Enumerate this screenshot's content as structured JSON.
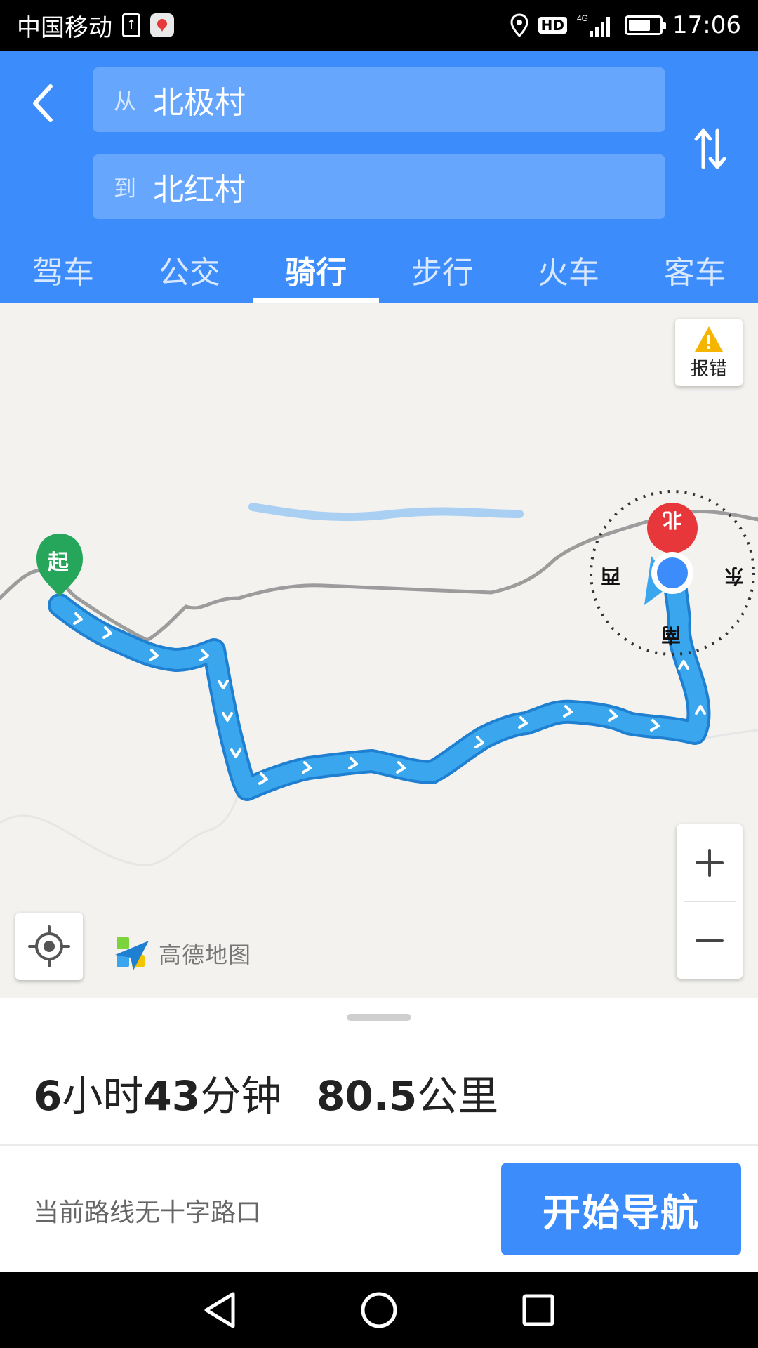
{
  "status_bar": {
    "carrier": "中国移动",
    "network": "4G",
    "hd": "HD",
    "time": "17:06"
  },
  "header": {
    "from_prefix": "从",
    "from_value": "北极村",
    "to_prefix": "到",
    "to_value": "北红村",
    "tabs": [
      {
        "label": "驾车",
        "active": false
      },
      {
        "label": "公交",
        "active": false
      },
      {
        "label": "骑行",
        "active": true
      },
      {
        "label": "步行",
        "active": false
      },
      {
        "label": "火车",
        "active": false
      },
      {
        "label": "客车",
        "active": false
      }
    ]
  },
  "map": {
    "start_marker_label": "起",
    "report_label": "报错",
    "logo_text": "高德地图",
    "compass": {
      "north": "北",
      "east": "东",
      "south": "南",
      "west": "西"
    },
    "route_color": "#3aa6ee",
    "accent_red": "#e8373a",
    "marker_green": "#26a65b"
  },
  "summary": {
    "hours": "6",
    "hours_unit": "小时",
    "minutes": "43",
    "minutes_unit": "分钟",
    "distance": "80.5",
    "distance_unit": "公里"
  },
  "route_note": "当前路线无十字路口",
  "start_nav_label": "开始导航"
}
